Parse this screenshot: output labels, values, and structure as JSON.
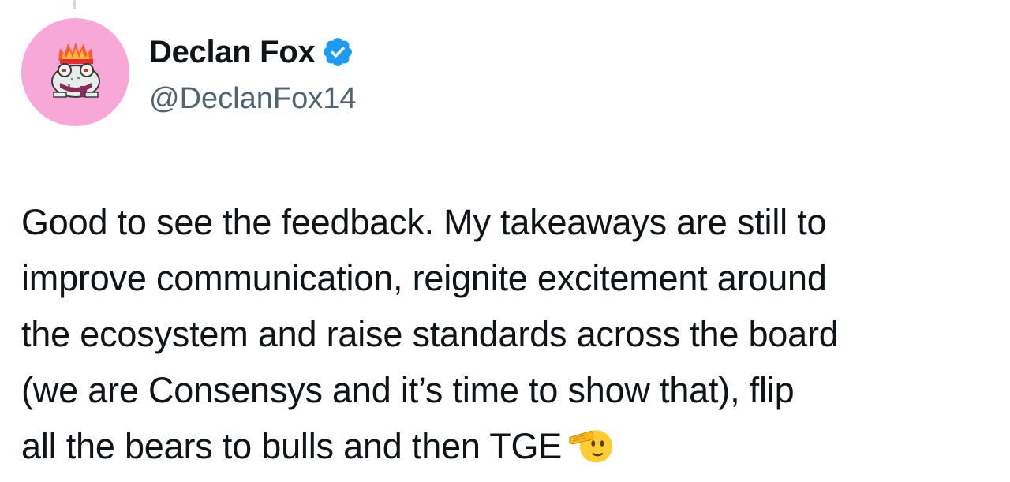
{
  "author": {
    "display_name": "Declan Fox",
    "handle": "@DeclanFox14",
    "verified": true,
    "avatar_icon": "pixel-frog-with-crown-avatar",
    "avatar_bg": "#f7a8d8",
    "verified_color": "#1d9bf0"
  },
  "tweet": {
    "text": "Good to see the feedback. My takeaways are still to\nimprove communication, reignite excitement around\nthe ecosystem and raise standards across the board\n(we are Consensys and it’s time to show that), flip\nall the bears to bulls and then TGE",
    "trailing_emoji": "saluting-face-emoji"
  }
}
